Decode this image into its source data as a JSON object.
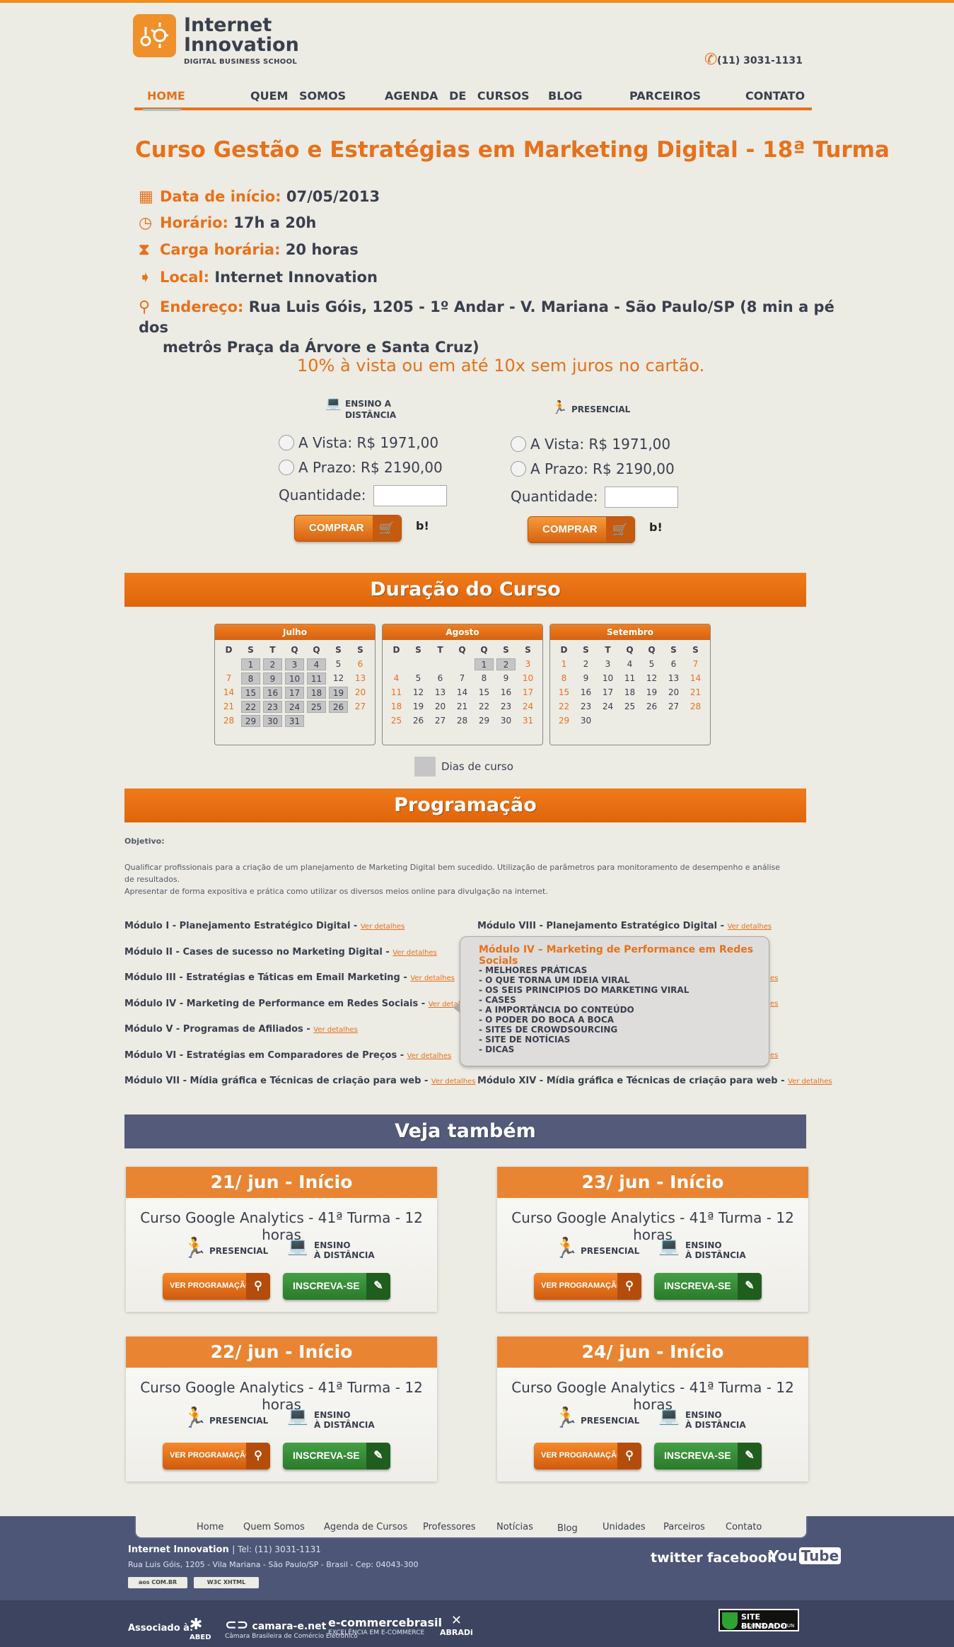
{
  "logo": {
    "line1": "Internet",
    "line2": "Innovation",
    "tagline": "DIGITAL BUSINESS SCHOOL"
  },
  "phone": "(11) 3031-1131",
  "nav": [
    {
      "label": "HOME"
    },
    {
      "label": "QUEM SOMOS"
    },
    {
      "label": "AGENDA DE CURSOS"
    },
    {
      "label": "BLOG"
    },
    {
      "label": "PARCEIROS"
    },
    {
      "label": "CONTATO"
    }
  ],
  "course": {
    "title": "Curso Gestão e Estratégias em Marketing Digital - 18ª Turma",
    "info": [
      {
        "label": "Data de início:",
        "value": "07/05/2013",
        "icon": "calendar-icon"
      },
      {
        "label": "Horário:",
        "value": "17h a 20h",
        "icon": "clock-icon"
      },
      {
        "label": "Carga horária:",
        "value": "20 horas",
        "icon": "hourglass-icon"
      },
      {
        "label": "Local:",
        "value": "Internet Innovation",
        "icon": "signpost-icon"
      },
      {
        "label": "Endereço:",
        "value": "Rua Luis Góis, 1205 - 1º Andar - V. Mariana - São Paulo/SP (8 min a pé dos",
        "value2": "metrôs Praça da Árvore e Santa Cruz)",
        "icon": "map-pin-icon"
      }
    ],
    "promo": "10% à vista ou em até 10x sem juros no cartão."
  },
  "purchase": {
    "ead": {
      "heading1": "ENSINO A",
      "heading2": "DISTÂNCIA",
      "vista": "A Vista: R$ 1971,00",
      "prazo": "A Prazo: R$ 2190,00",
      "qty_label": "Quantidade:",
      "buy": "COMPRAR"
    },
    "presencial": {
      "heading1": "PRESENCIAL",
      "vista": "A Vista: R$ 1971,00",
      "prazo": "A Prazo: R$ 2190,00",
      "qty_label": "Quantidade:",
      "buy": "COMPRAR"
    },
    "bcash": "b!"
  },
  "duration": {
    "title": "Duração do Curso",
    "weekdays": [
      "D",
      "S",
      "T",
      "Q",
      "Q",
      "S",
      "S"
    ],
    "months": [
      {
        "name": "Julho",
        "start": 1,
        "days": 31,
        "selected": [
          1,
          2,
          3,
          4,
          8,
          9,
          10,
          11,
          15,
          16,
          17,
          18,
          19,
          22,
          23,
          24,
          25,
          26,
          29,
          30,
          31
        ]
      },
      {
        "name": "Agosto",
        "start": 4,
        "days": 31,
        "selected": [
          1,
          2
        ]
      },
      {
        "name": "Setembro",
        "start": 0,
        "days": 30,
        "selected": []
      }
    ],
    "legend": "Dias de curso"
  },
  "programacao": {
    "title": "Programação",
    "objetivo_label": "Objetivo:",
    "p1": "Qualificar profissionais para a criação de um planejamento de Marketing Digital bem sucedido. Utilização de parâmetros para monitoramento de desempenho e análise",
    "p2": "de resultados.",
    "p3": "Apresentar de forma expositiva e prática como utilizar os diversos meios online para divulgação na internet.",
    "details_label": "Ver detalhes",
    "modules_left": [
      "Módulo I - Planejamento Estratégico Digital -",
      "Módulo II - Cases de sucesso no Marketing Digital -",
      "Módulo III - Estratégias e Táticas em Email Marketing -",
      "Módulo IV - Marketing de Performance em Redes Sociais -",
      "Módulo V - Programas de Afiliados -",
      "Módulo VI - Estratégias em Comparadores de Preços -",
      "Módulo VII - Mídia gráfica e Técnicas de criação para web -"
    ],
    "modules_right": [
      "Módulo VIII - Planejamento Estratégico Digital -",
      "Módulo XIV - Mídia gráfica e Técnicas de criação para web -"
    ],
    "tooltip": {
      "title": "Módulo IV – Marketing de Performance em Redes Socials",
      "items": [
        "- MELHORES PRÁTICAS",
        "- O QUE TORNA UM IDEIA VIRAL",
        "- OS SEIS PRINCIPIOS DO MARKETING VIRAL",
        "- CASES",
        "- A IMPORTÂNCIA DO CONTEÚDO",
        "- O PODER DO BOCA A BOCA",
        "- SITES DE CROWDSOURCING",
        "- SITE DE NOTÍCIAS",
        "- DICAS"
      ],
      "hidden_fragment": "es"
    }
  },
  "veja": {
    "title": "Veja também",
    "cards": [
      {
        "date": "21/ jun - Início",
        "course": "Curso Google Analytics - 41ª Turma - 12 horas"
      },
      {
        "date": "23/ jun - Início",
        "course": "Curso Google Analytics - 41ª Turma - 12 horas"
      },
      {
        "date": "22/ jun - Início",
        "course": "Curso Google Analytics - 41ª Turma - 12 horas"
      },
      {
        "date": "24/ jun - Início",
        "course": "Curso Google Analytics - 41ª Turma - 12 horas"
      }
    ],
    "presencial": "PRESENCIAL",
    "ead1": "ENSINO",
    "ead2": "À DISTÂNCIA",
    "ver_prog": "VER PROGRAMAÇÃO",
    "inscreva": "INSCREVA-SE"
  },
  "footer": {
    "nav": [
      "Home",
      "Quem Somos",
      "Agenda de Cursos",
      "Professores",
      "Notícias",
      "Blog",
      "Unidades",
      "Parceiros",
      "Contato"
    ],
    "company": "Internet Innovation",
    "tel": "| Tel: (11) 3031-1131",
    "address": "Rua Luis Góis, 1205 - Vila Mariana - São Paulo/SP - Brasil - Cep: 04043-300",
    "badge1": "aos COM.BR",
    "badge2": "W3C XHTML",
    "twitter": "twitter",
    "facebook": "facebook",
    "youtube1": "You",
    "youtube2": "Tube",
    "assoc": "Associado à:",
    "partners": [
      {
        "name": "ABED",
        "sub": ""
      },
      {
        "name": "camara-e.net",
        "sub": "Câmara Brasileira de Comércio Eletrônico"
      },
      {
        "name": "e-commercebrasil",
        "sub": "EXCELÊNCIA EM E-COMMERCE"
      },
      {
        "name": "ABRADi",
        "sub": ""
      }
    ],
    "blindado1": "SITE BLINDADO",
    "blindado2": "AUDITADO EM 19 JUN"
  }
}
